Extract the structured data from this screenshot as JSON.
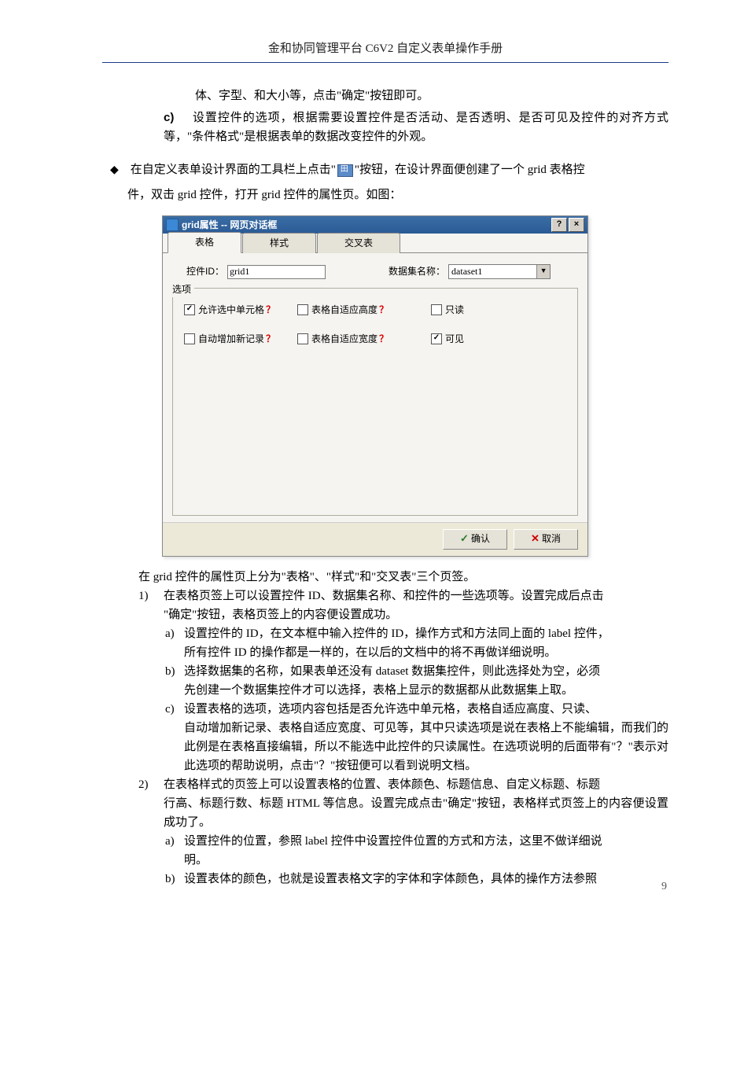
{
  "header": {
    "title": "金和协同管理平台 C6V2 自定义表单操作手册"
  },
  "intro": {
    "tail_line": "体、字型、和大小等，点击\"确定\"按钮即可。",
    "item_c_label": "c)",
    "item_c_text": "设置控件的选项，根据需要设置控件是否活动、是否透明、是否可见及控件的对齐方式等，\"条件格式\"是根据表单的数据改变控件的外观。"
  },
  "diamond": {
    "line1a": "在自定义表单设计界面的工具栏上点击\"",
    "line1b": "\"按钮，在设计界面便创建了一个 grid 表格控",
    "line2": "件，双击 grid 控件，打开 grid 控件的属性页。如图："
  },
  "dialog": {
    "title": "grid属性 -- 网页对话框",
    "help_btn": "?",
    "close_btn": "×",
    "tabs": [
      "表格",
      "样式",
      "交叉表"
    ],
    "active_tab": 0,
    "control_id_label": "控件ID：",
    "control_id_value": "grid1",
    "dataset_label": "数据集名称：",
    "dataset_value": "dataset1",
    "options_legend": "选项",
    "options": {
      "row1": [
        {
          "label": "允许选中单元格",
          "checked": true,
          "help": true
        },
        {
          "label": "表格自适应高度",
          "checked": false,
          "help": true
        },
        {
          "label": "只读",
          "checked": false,
          "help": false
        }
      ],
      "row2": [
        {
          "label": "自动增加新记录",
          "checked": false,
          "help": true
        },
        {
          "label": "表格自适应宽度",
          "checked": false,
          "help": true
        },
        {
          "label": "可见",
          "checked": true,
          "help": false
        }
      ]
    },
    "ok_label": "确认",
    "cancel_label": "取消"
  },
  "after": {
    "p1": "在 grid 控件的属性页上分为\"表格\"、\"样式\"和\"交叉表\"三个页签。",
    "n1_label": "1)",
    "n1_text": "在表格页签上可以设置控件 ID、数据集名称、和控件的一些选项等。设置完成后点击\"确定\"按钮，表格页签上的内容便设置成功。",
    "n1a_label": "a)",
    "n1a_text": "设置控件的 ID，在文本框中输入控件的 ID，操作方式和方法同上面的 label 控件，所有控件 ID 的操作都是一样的，在以后的文档中的将不再做详细说明。",
    "n1b_label": "b)",
    "n1b_text": "选择数据集的名称，如果表单还没有 dataset 数据集控件，则此选择处为空，必须先创建一个数据集控件才可以选择，表格上显示的数据都从此数据集上取。",
    "n1c_label": "c)",
    "n1c_text": "设置表格的选项，选项内容包括是否允许选中单元格，表格自适应高度、只读、自动增加新记录、表格自适应宽度、可见等，其中只读选项是说在表格上不能编辑，而我们的此例是在表格直接编辑，所以不能选中此控件的只读属性。在选项说明的后面带有\"？\"表示对此选项的帮助说明，点击\"？\"按钮便可以看到说明文档。",
    "n2_label": "2)",
    "n2_text": "在表格样式的页签上可以设置表格的位置、表体颜色、标题信息、自定义标题、标题行高、标题行数、标题 HTML 等信息。设置完成点击\"确定\"按钮，表格样式页签上的内容便设置成功了。",
    "n2a_label": "a)",
    "n2a_text": "设置控件的位置，参照 label 控件中设置控件位置的方式和方法，这里不做详细说明。",
    "n2b_label": "b)",
    "n2b_text": "设置表体的颜色，也就是设置表格文字的字体和字体颜色，具体的操作方法参照"
  },
  "page_number": "9"
}
